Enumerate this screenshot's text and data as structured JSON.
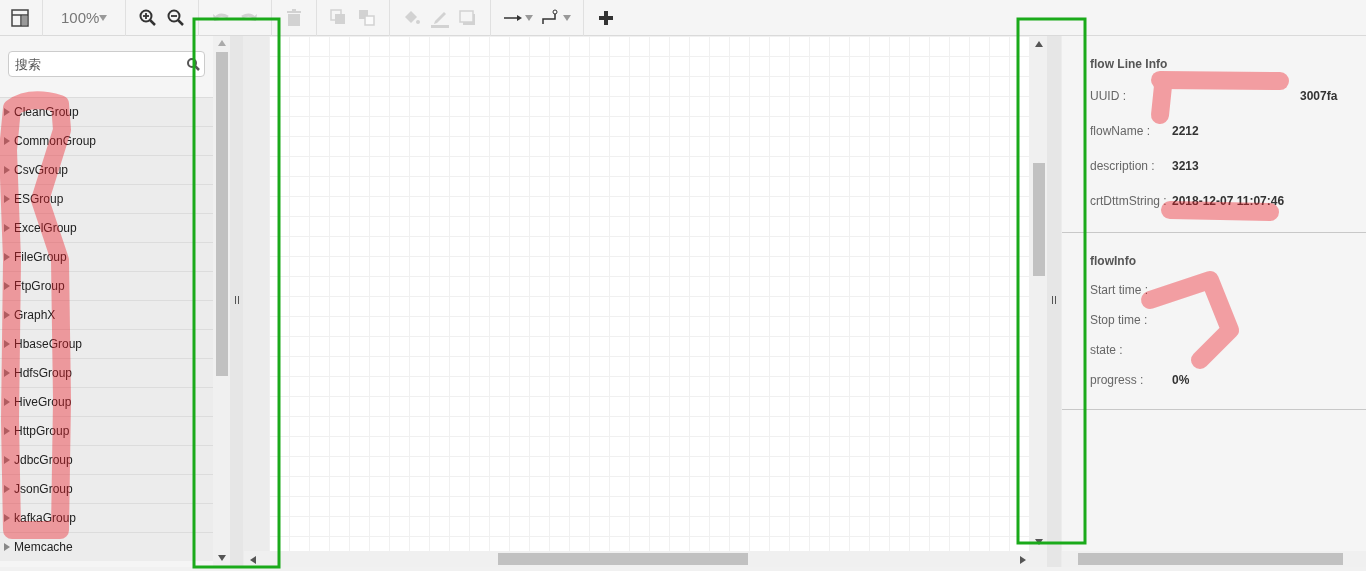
{
  "toolbar": {
    "zoom": "100%",
    "tools": [
      {
        "kind": "layout",
        "disabled": false
      },
      {
        "kind": "zoom"
      },
      {
        "kind": "zoom-in",
        "disabled": false
      },
      {
        "kind": "zoom-out",
        "disabled": false
      },
      {
        "kind": "undo",
        "disabled": true
      },
      {
        "kind": "redo",
        "disabled": true
      },
      {
        "kind": "delete",
        "disabled": true
      },
      {
        "kind": "to-front",
        "disabled": true
      },
      {
        "kind": "to-back",
        "disabled": true
      },
      {
        "kind": "fill",
        "disabled": true
      },
      {
        "kind": "line-color",
        "disabled": true
      },
      {
        "kind": "shadow",
        "disabled": true
      },
      {
        "kind": "connection",
        "disabled": false
      },
      {
        "kind": "waypoints",
        "disabled": false
      },
      {
        "kind": "add",
        "disabled": false
      }
    ]
  },
  "sidebar": {
    "search": {
      "placeholder": "搜索"
    },
    "items": [
      {
        "label": "CleanGroup",
        "expanded": false
      },
      {
        "label": "CommonGroup",
        "expanded": false
      },
      {
        "label": "CsvGroup",
        "expanded": false
      },
      {
        "label": "ESGroup",
        "expanded": false
      },
      {
        "label": "ExcelGroup",
        "expanded": false
      },
      {
        "label": "FileGroup",
        "expanded": false
      },
      {
        "label": "FtpGroup",
        "expanded": false
      },
      {
        "label": "GraphX",
        "expanded": false
      },
      {
        "label": "HbaseGroup",
        "expanded": false
      },
      {
        "label": "HdfsGroup",
        "expanded": false
      },
      {
        "label": "HiveGroup",
        "expanded": false
      },
      {
        "label": "HttpGroup",
        "expanded": false
      },
      {
        "label": "JdbcGroup",
        "expanded": false
      },
      {
        "label": "JsonGroup",
        "expanded": false
      },
      {
        "label": "kafkaGroup",
        "expanded": false
      },
      {
        "label": "Memcache",
        "expanded": false
      }
    ]
  },
  "panel": {
    "sections": [
      {
        "title": "flow Line Info",
        "rows": [
          {
            "label": "UUID :",
            "value": "3007fa"
          },
          {
            "label": "flowName :",
            "value": "2212"
          },
          {
            "label": "description :",
            "value": "3213"
          },
          {
            "label": "crtDttmString :",
            "value": "2018-12-07 11:07:46"
          }
        ]
      },
      {
        "title": "flowInfo",
        "rows": [
          {
            "label": "Start time :"
          },
          {
            "label": "Stop time :"
          },
          {
            "label": "state :"
          },
          {
            "label": "progress :",
            "value": "0%"
          }
        ]
      }
    ]
  }
}
